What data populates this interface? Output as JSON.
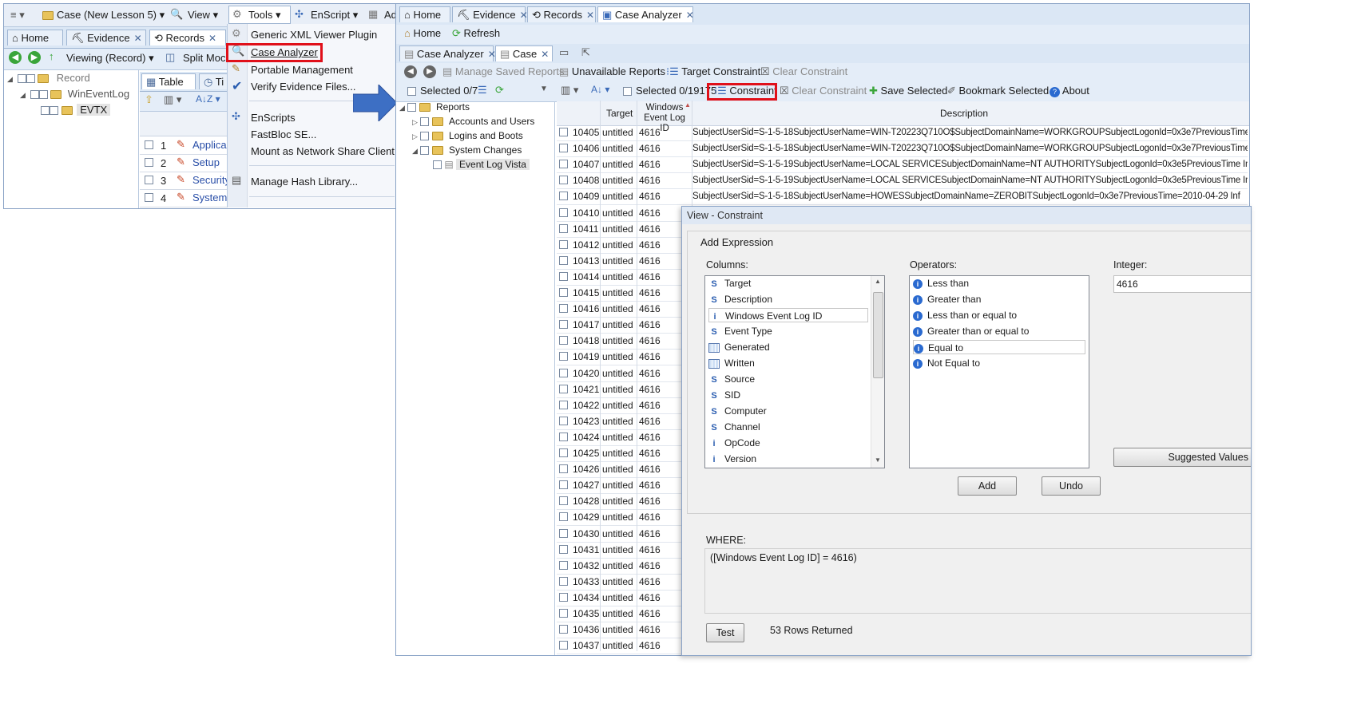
{
  "left_window": {
    "menubar": {
      "case_label": "Case (New Lesson 5)",
      "view_label": "View",
      "tools_label": "Tools",
      "enscript_label": "EnScript",
      "add_label": "Ad"
    },
    "tabs": [
      {
        "label": "Home"
      },
      {
        "label": "Evidence"
      },
      {
        "label": "Records"
      }
    ],
    "toolbar": {
      "viewing_label": "Viewing (Record)",
      "split_label": "Split Moc"
    },
    "tree": [
      {
        "label": "Record"
      },
      {
        "label": "WinEventLog"
      },
      {
        "label": "EVTX"
      }
    ],
    "subtabs": {
      "table_label": "Table",
      "timeline_label": "Ti"
    },
    "rows": [
      {
        "num": "1",
        "name": "Applica"
      },
      {
        "num": "2",
        "name": "Setup"
      },
      {
        "num": "3",
        "name": "Security"
      },
      {
        "num": "4",
        "name": "System"
      }
    ]
  },
  "tools_menu": {
    "items": [
      {
        "label": "Generic XML Viewer Plugin"
      },
      {
        "label": "Case Analyzer"
      },
      {
        "label": "Portable Management"
      },
      {
        "label": "Verify Evidence Files..."
      },
      {
        "label": "EnScripts"
      },
      {
        "label": "FastBloc SE..."
      },
      {
        "label": "Mount as Network Share Client"
      },
      {
        "label": "Manage Hash Library..."
      }
    ]
  },
  "right_window": {
    "tabs": [
      {
        "label": "Home"
      },
      {
        "label": "Evidence"
      },
      {
        "label": "Records"
      },
      {
        "label": "Case Analyzer"
      }
    ],
    "toolbar1": {
      "home_label": "Home",
      "refresh_label": "Refresh"
    },
    "subtabs": [
      {
        "label": "Case Analyzer"
      },
      {
        "label": "Case"
      }
    ],
    "toolbar2": {
      "manage_label": "Manage Saved Reports",
      "unavailable_label": "Unavailable Reports",
      "target_label": "Target Constraint",
      "clear_label": "Clear Constraint"
    },
    "toolbar3": {
      "selected_left": "Selected 0/7",
      "selected_right": "Selected 0/19175",
      "constraint_label": "Constraint",
      "clear_label": "Clear Constraint",
      "save_label": "Save Selected",
      "bookmark_label": "Bookmark Selected",
      "about_label": "About"
    },
    "tree": [
      {
        "label": "Reports"
      },
      {
        "label": "Accounts and Users"
      },
      {
        "label": "Logins and Boots"
      },
      {
        "label": "System Changes"
      },
      {
        "label": "Event Log Vista"
      }
    ],
    "table": {
      "headers": {
        "target": "Target",
        "evt_line1": "Windows",
        "evt_line2": "Event Log ID",
        "desc": "Description"
      },
      "rows": [
        {
          "num": "10405",
          "target": "untitled",
          "evt": "4616",
          "desc": "SubjectUserSid=S-1-5-18SubjectUserName=WIN-T20223Q710O$SubjectDomainName=WORKGROUPSubjectLogonId=0x3e7PreviousTime  Inf"
        },
        {
          "num": "10406",
          "target": "untitled",
          "evt": "4616",
          "desc": "SubjectUserSid=S-1-5-18SubjectUserName=WIN-T20223Q710O$SubjectDomainName=WORKGROUPSubjectLogonId=0x3e7PreviousTime  Inf"
        },
        {
          "num": "10407",
          "target": "untitled",
          "evt": "4616",
          "desc": "SubjectUserSid=S-1-5-19SubjectUserName=LOCAL SERVICESubjectDomainName=NT AUTHORITYSubjectLogonId=0x3e5PreviousTime  Inf"
        },
        {
          "num": "10408",
          "target": "untitled",
          "evt": "4616",
          "desc": "SubjectUserSid=S-1-5-19SubjectUserName=LOCAL SERVICESubjectDomainName=NT AUTHORITYSubjectLogonId=0x3e5PreviousTime  Inf"
        },
        {
          "num": "10409",
          "target": "untitled",
          "evt": "4616",
          "desc": "SubjectUserSid=S-1-5-18SubjectUserName=HOWESSubjectDomainName=ZEROBITSubjectLogonId=0x3e7PreviousTime=2010-04-29  Inf"
        },
        {
          "num": "10410",
          "target": "untitled",
          "evt": "4616",
          "desc": ""
        },
        {
          "num": "10411",
          "target": "untitled",
          "evt": "4616",
          "desc": ""
        },
        {
          "num": "10412",
          "target": "untitled",
          "evt": "4616",
          "desc": ""
        },
        {
          "num": "10413",
          "target": "untitled",
          "evt": "4616",
          "desc": ""
        },
        {
          "num": "10414",
          "target": "untitled",
          "evt": "4616",
          "desc": ""
        },
        {
          "num": "10415",
          "target": "untitled",
          "evt": "4616",
          "desc": ""
        },
        {
          "num": "10416",
          "target": "untitled",
          "evt": "4616",
          "desc": ""
        },
        {
          "num": "10417",
          "target": "untitled",
          "evt": "4616",
          "desc": ""
        },
        {
          "num": "10418",
          "target": "untitled",
          "evt": "4616",
          "desc": ""
        },
        {
          "num": "10419",
          "target": "untitled",
          "evt": "4616",
          "desc": ""
        },
        {
          "num": "10420",
          "target": "untitled",
          "evt": "4616",
          "desc": ""
        },
        {
          "num": "10421",
          "target": "untitled",
          "evt": "4616",
          "desc": ""
        },
        {
          "num": "10422",
          "target": "untitled",
          "evt": "4616",
          "desc": ""
        },
        {
          "num": "10423",
          "target": "untitled",
          "evt": "4616",
          "desc": ""
        },
        {
          "num": "10424",
          "target": "untitled",
          "evt": "4616",
          "desc": ""
        },
        {
          "num": "10425",
          "target": "untitled",
          "evt": "4616",
          "desc": ""
        },
        {
          "num": "10426",
          "target": "untitled",
          "evt": "4616",
          "desc": ""
        },
        {
          "num": "10427",
          "target": "untitled",
          "evt": "4616",
          "desc": ""
        },
        {
          "num": "10428",
          "target": "untitled",
          "evt": "4616",
          "desc": ""
        },
        {
          "num": "10429",
          "target": "untitled",
          "evt": "4616",
          "desc": ""
        },
        {
          "num": "10430",
          "target": "untitled",
          "evt": "4616",
          "desc": ""
        },
        {
          "num": "10431",
          "target": "untitled",
          "evt": "4616",
          "desc": ""
        },
        {
          "num": "10432",
          "target": "untitled",
          "evt": "4616",
          "desc": ""
        },
        {
          "num": "10433",
          "target": "untitled",
          "evt": "4616",
          "desc": ""
        },
        {
          "num": "10434",
          "target": "untitled",
          "evt": "4616",
          "desc": ""
        },
        {
          "num": "10435",
          "target": "untitled",
          "evt": "4616",
          "desc": ""
        },
        {
          "num": "10436",
          "target": "untitled",
          "evt": "4616",
          "desc": ""
        },
        {
          "num": "10437",
          "target": "untitled",
          "evt": "4616",
          "desc": ""
        }
      ]
    }
  },
  "dialog": {
    "title": "View - Constraint",
    "group_label": "Add Expression",
    "columns_label": "Columns:",
    "operators_label": "Operators:",
    "integer_label": "Integer:",
    "integer_value": "4616",
    "columns": [
      {
        "type": "S",
        "label": "Target"
      },
      {
        "type": "S",
        "label": "Description"
      },
      {
        "type": "i",
        "label": "Windows Event Log ID"
      },
      {
        "type": "S",
        "label": "Event Type"
      },
      {
        "type": "date",
        "label": "Generated"
      },
      {
        "type": "date",
        "label": "Written"
      },
      {
        "type": "S",
        "label": "Source"
      },
      {
        "type": "S",
        "label": "SID"
      },
      {
        "type": "S",
        "label": "Computer"
      },
      {
        "type": "S",
        "label": "Channel"
      },
      {
        "type": "i",
        "label": "OpCode"
      },
      {
        "type": "i",
        "label": "Version"
      }
    ],
    "operators": [
      {
        "label": "Less than"
      },
      {
        "label": "Greater than"
      },
      {
        "label": "Less than or equal to"
      },
      {
        "label": "Greater than or equal to"
      },
      {
        "label": "Equal to"
      },
      {
        "label": "Not Equal to"
      }
    ],
    "suggested_label": "Suggested Values",
    "add_label": "Add",
    "undo_label": "Undo",
    "where_label": "WHERE:",
    "where_expr": "([Windows Event Log ID] = 4616)",
    "test_label": "Test",
    "rows_returned": "53 Rows Returned"
  },
  "colors": {
    "highlight_red": "#e0101a",
    "arrow_blue": "#3d6fc4",
    "chrome_blue": "#dbe7f5"
  }
}
